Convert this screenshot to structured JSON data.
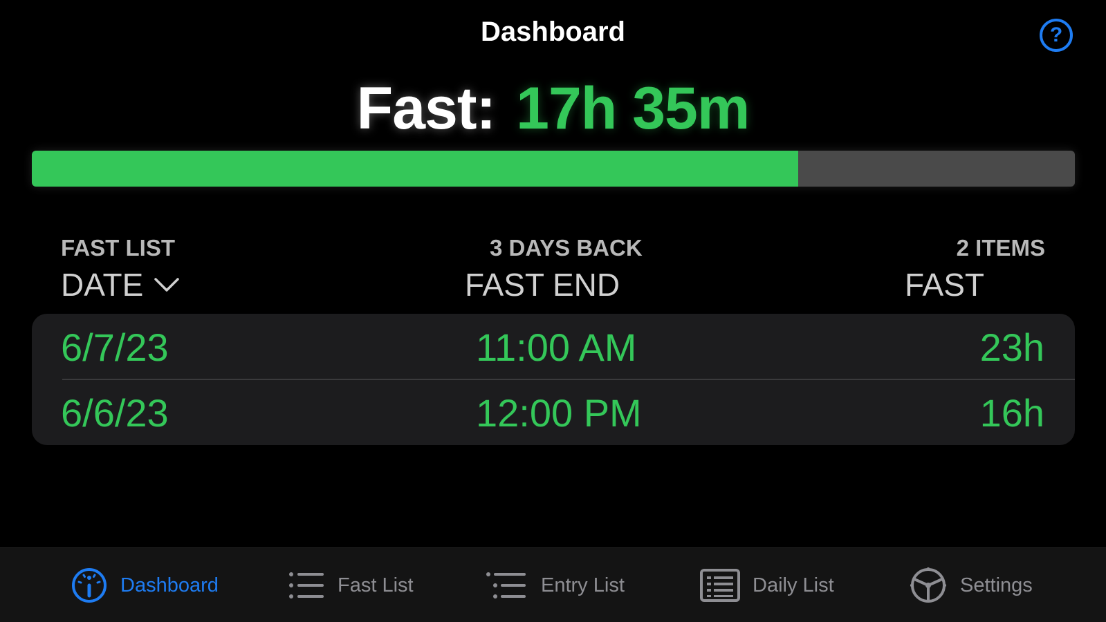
{
  "nav": {
    "title": "Dashboard",
    "help_symbol": "?"
  },
  "fast": {
    "label": "Fast:",
    "value": "17h 35m",
    "progress": 0.735
  },
  "list": {
    "section_title": "FAST LIST",
    "range": "3 DAYS BACK",
    "count": "2 ITEMS",
    "columns": {
      "date": "DATE",
      "fast_end": "FAST END",
      "fast": "FAST"
    },
    "rows": [
      {
        "date": "6/7/23",
        "fast_end": "11:00 AM",
        "fast": "23h"
      },
      {
        "date": "6/6/23",
        "fast_end": "12:00 PM",
        "fast": "16h"
      }
    ]
  },
  "tabs": [
    {
      "label": "Dashboard",
      "icon": "gauge-icon",
      "active": true
    },
    {
      "label": "Fast List",
      "icon": "list-icon",
      "active": false
    },
    {
      "label": "Entry List",
      "icon": "indented-list-icon",
      "active": false
    },
    {
      "label": "Daily List",
      "icon": "document-list-icon",
      "active": false
    },
    {
      "label": "Settings",
      "icon": "steering-wheel-icon",
      "active": false
    }
  ],
  "colors": {
    "accent_green": "#34c759",
    "accent_blue": "#1e7cf2",
    "track_gray": "#4a4a4a",
    "card_bg": "#1c1c1e",
    "inactive_gray": "#8e8e93"
  }
}
